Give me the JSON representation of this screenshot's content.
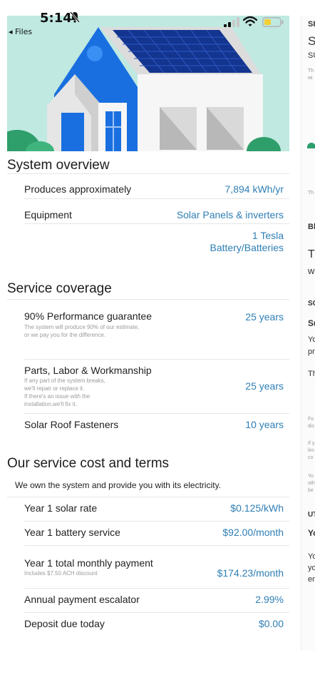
{
  "status_bar": {
    "time": "5:14",
    "back_label": "◂ Files"
  },
  "system_overview": {
    "title": "System overview",
    "rows": [
      {
        "label": "Produces approximately",
        "value": "7,894 kWh/yr"
      },
      {
        "label": "Equipment",
        "value": "Solar Panels & inverters"
      }
    ],
    "extra_value_line1": "1 Tesla",
    "extra_value_line2": "Battery/Batteries"
  },
  "service_coverage": {
    "title": "Service coverage",
    "performance": {
      "label": "90% Performance guarantee",
      "note_line1": "The system will produce 90% of our estimate,",
      "note_line2": "or we pay you for the difference.",
      "value": "25 years"
    },
    "parts": {
      "label": "Parts, Labor & Workmanship",
      "note_line1": "If any part of the system breaks,",
      "note_line2": "we'll repair or replace it.",
      "note_line3": "If there's an issue with the",
      "note_line4": "installation,we'll fix it.",
      "value": "25 years"
    },
    "fasteners": {
      "label": "Solar Roof Fasteners",
      "value": "10 years"
    }
  },
  "cost_terms": {
    "title": "Our service cost and terms",
    "intro": "We own the system and provide you with its electricity.",
    "rows": [
      {
        "label": "Year 1 solar rate",
        "value": "$0.125/kWh"
      },
      {
        "label": "Year 1 battery service",
        "value": "$92.00/month"
      }
    ],
    "total": {
      "label": "Year 1 total monthly payment",
      "note": "Includes $7.50 ACH discount",
      "value": "$174.23/month"
    },
    "escalator": {
      "label": "Annual payment escalator",
      "value": "2.99%"
    },
    "deposit": {
      "label": "Deposit due today",
      "value": "$0.00"
    }
  },
  "right_panel": {
    "t1": "SI",
    "t2": "S",
    "t3": "SU",
    "t4": "Th",
    "t5": "wi",
    "t6": "Th",
    "t7": "Bl",
    "t8": "T",
    "t9": "w",
    "t10": "SC",
    "t11": "Su",
    "t12": "Yo",
    "t13": "pr",
    "t14": "Th",
    "t15": "Fo",
    "t16": "dis",
    "t17": "If y",
    "t18": "lim",
    "t19": "co",
    "t20": "Yo",
    "t21": "oth",
    "t22": "be",
    "t23": "UT",
    "t24": "Yo",
    "t25": "Yo",
    "t26": "yo",
    "t27": "en"
  },
  "colors": {
    "link_blue": "#2f7fb5",
    "house_blue": "#1a6fe0",
    "sky": "#bfe9e1",
    "panel_navy": "#13358f",
    "bush_green": "#2e9e6a"
  }
}
